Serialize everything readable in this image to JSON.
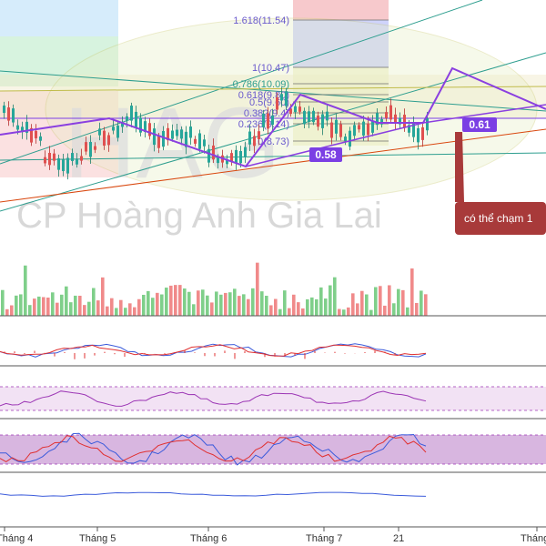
{
  "chart_data": [
    {
      "type": "candlestick",
      "panel": "price",
      "watermark_symbol": "HAG",
      "watermark_name": "CP Hoàng Anh Gia Lai",
      "x_ticks": [
        "Tháng 4",
        "Tháng 5",
        "Tháng 6",
        "Tháng 7",
        "21",
        "Tháng"
      ],
      "fibonacci_levels": [
        {
          "label": "1.618(11.54)",
          "ratio": 1.618,
          "price": 11.54
        },
        {
          "label": "1(10.47)",
          "ratio": 1,
          "price": 10.47
        },
        {
          "label": "0.786(10.09)",
          "ratio": 0.786,
          "price": 10.09
        },
        {
          "label": "0.618(9.80)",
          "ratio": 0.618,
          "price": 9.8
        },
        {
          "label": "0.5(9.60)",
          "ratio": 0.5,
          "price": 9.6
        },
        {
          "label": "0.382(9.4)",
          "ratio": 0.382,
          "price": 9.4
        },
        {
          "label": "0.236(9.14)",
          "ratio": 0.236,
          "price": 9.14
        },
        {
          "label": "0(8.73)",
          "ratio": 0,
          "price": 8.73
        }
      ],
      "badges": [
        {
          "label": "0.58",
          "color": "#7b3fe4"
        },
        {
          "label": "0.61",
          "color": "#7b3fe4"
        }
      ],
      "callout": {
        "text": "có thể chạm 1",
        "color": "#a83a3a"
      },
      "colors": {
        "up": "#26a69a",
        "down": "#e05050",
        "pattern": "#8a3fe0",
        "fib": "#6a5acd"
      }
    },
    {
      "type": "bar",
      "panel": "volume",
      "colors": {
        "up": "#7fcf8a",
        "down": "#f08a8a"
      }
    },
    {
      "type": "line",
      "panel": "macd",
      "series_colors": [
        "#3b5bdb",
        "#e03131"
      ]
    },
    {
      "type": "line",
      "panel": "rsi",
      "series_colors": [
        "#9c36b5"
      ]
    },
    {
      "type": "line",
      "panel": "stochastic",
      "series_colors": [
        "#3b5bdb",
        "#e03131"
      ]
    },
    {
      "type": "line",
      "panel": "indicator",
      "series_colors": [
        "#3b5bdb"
      ]
    }
  ]
}
